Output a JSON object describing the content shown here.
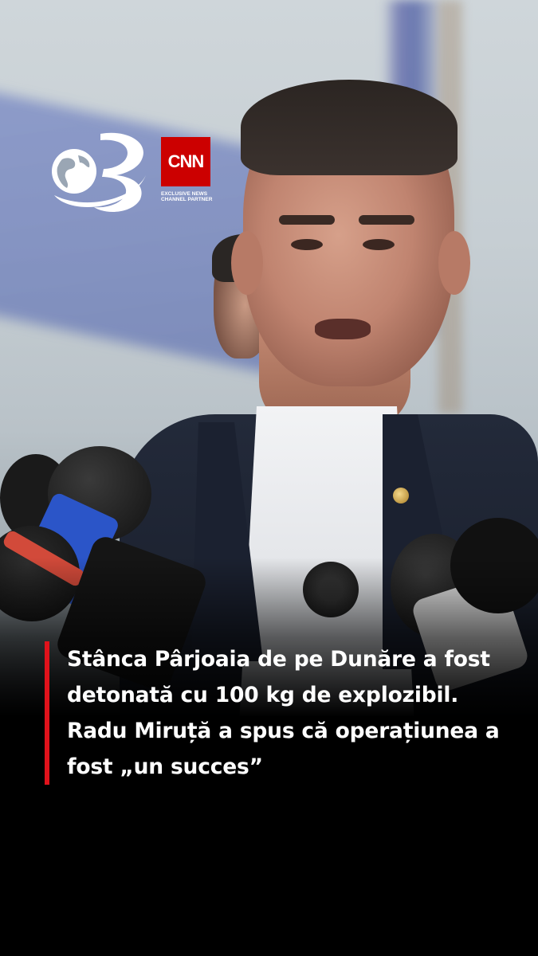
{
  "brand": {
    "channel_logo_icon": "antena3-globe-icon",
    "partner_logo_text": "CNN",
    "partner_tagline": "EXCLUSIVE NEWS CHANNEL PARTNER",
    "partner_color": "#cc0000"
  },
  "headline": {
    "text": "Stânca Pârjoaia de pe Dunăre a fost detonată cu 100 kg de explozibil. Radu Miruță a spus că operațiunea a fost „un succes”",
    "accent_color": "#e0121b"
  }
}
